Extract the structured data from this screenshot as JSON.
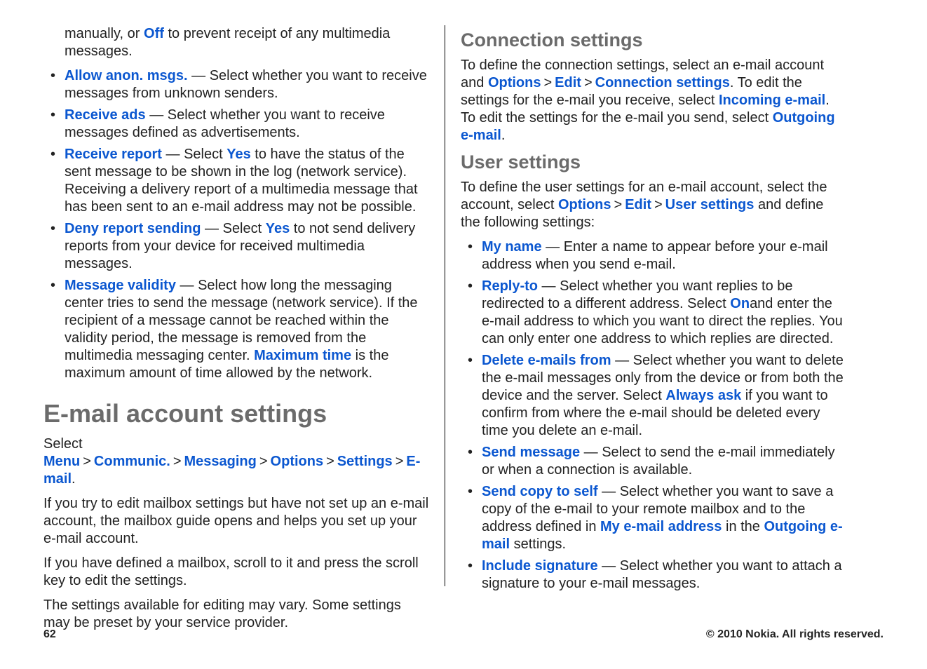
{
  "left": {
    "intro_pre": "manually, or ",
    "intro_off": "Off",
    "intro_post": " to prevent receipt of any multimedia messages.",
    "items": [
      {
        "term": "Allow anon. msgs.",
        "desc": " — Select whether you want to receive messages from unknown senders."
      },
      {
        "term": "Receive ads",
        "desc": " — Select whether you want to receive messages defined as advertisements."
      },
      {
        "term": "Receive report",
        "pre": " — Select ",
        "kw": "Yes",
        "post": " to have the status of the sent message to be shown in the log (network service). Receiving a delivery report of a multimedia message that has been sent to an e-mail address may not be possible."
      },
      {
        "term": "Deny report sending",
        "pre": " — Select ",
        "kw": "Yes",
        "post": " to not send delivery reports from your device for received multimedia messages."
      },
      {
        "term": "Message validity",
        "pre": " — Select how long the messaging center tries to send the message (network service). If the recipient of a message cannot be reached within the validity period, the message is removed from the multimedia messaging center. ",
        "kw": "Maximum time",
        "post": " is the maximum amount of time allowed by the network."
      }
    ],
    "h1": "E-mail account settings",
    "nav": {
      "select": "Select ",
      "menu": "Menu",
      "communic": "Communic.",
      "messaging": "Messaging",
      "options": "Options",
      "settings": "Settings",
      "email": "E-mail"
    },
    "p1": "If you try to edit mailbox settings but have not set up an e-mail account, the mailbox guide opens and helps you set up your e-mail account.",
    "p2": "If you have defined a mailbox, scroll to it and press the scroll key to edit the settings.",
    "p3": "The settings available for editing may vary. Some settings may be preset by your service provider."
  },
  "right": {
    "h_conn": "Connection settings",
    "conn": {
      "t1": "To define the connection settings, select an e-mail account and ",
      "options": "Options",
      "edit": "Edit",
      "cs": "Connection settings",
      "t2": ". To edit the settings for the e-mail you receive, select ",
      "inc": "Incoming e-mail",
      "t3": ". To edit the settings for the e-mail you send, select ",
      "out": "Outgoing e-mail",
      "t4": "."
    },
    "h_user": "User settings",
    "user_p": {
      "t1": "To define the user settings for an e-mail account, select the account, select ",
      "options": "Options",
      "edit": "Edit",
      "us": "User settings",
      "t2": " and define the following settings:"
    },
    "items": [
      {
        "term": "My name",
        "desc": " — Enter a name to appear before your e-mail address when you send e-mail."
      },
      {
        "term": "Reply-to",
        "pre": " — Select whether you want replies to be redirected to a different address. Select ",
        "kw": "On",
        "post": "and enter the e-mail address to which you want to direct the replies. You can only enter one address to which replies are directed."
      },
      {
        "term": "Delete e-mails from",
        "pre": " — Select whether you want to delete the e-mail messages only from the device or from both the device and the server. Select ",
        "kw": "Always ask",
        "post": " if you want to confirm from where the e-mail should be deleted every time you delete an e-mail."
      },
      {
        "term": "Send message",
        "desc": " — Select to send the e-mail immediately or when a connection is available."
      },
      {
        "term": "Send copy to self",
        "pre": " — Select whether you want to save a copy of the e-mail to your remote mailbox and to the address defined in ",
        "kw": "My e-mail address",
        "post_pre": " in the ",
        "kw2": "Outgoing e-mail",
        "post": " settings."
      },
      {
        "term": "Include signature",
        "desc": " — Select whether you want to attach a signature to your e-mail messages."
      }
    ]
  },
  "footer": {
    "page": "62",
    "copyright": "© 2010 Nokia. All rights reserved."
  },
  "gt": ">"
}
